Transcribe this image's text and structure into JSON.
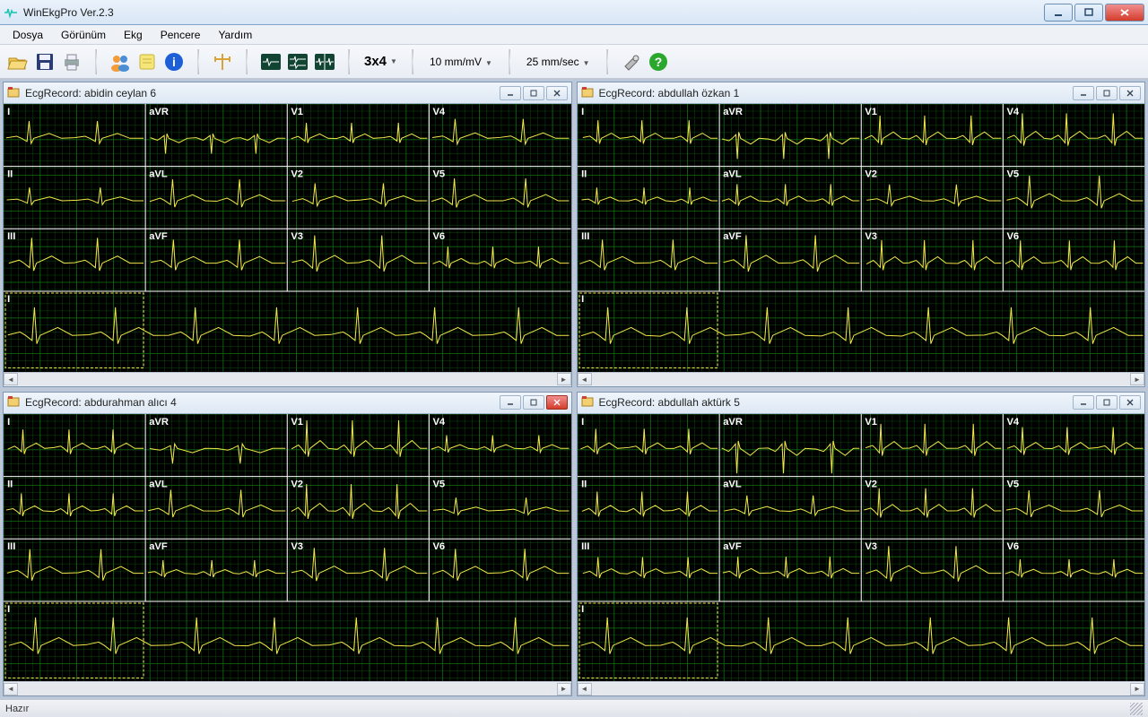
{
  "app": {
    "title": "WinEkgPro Ver.2.3"
  },
  "menu": {
    "items": [
      "Dosya",
      "Görünüm",
      "Ekg",
      "Pencere",
      "Yardım"
    ]
  },
  "toolbar": {
    "layout_label": "3x4",
    "gain": "10 mm/mV",
    "speed": "25 mm/sec"
  },
  "lead_labels": {
    "col0": [
      "I",
      "II",
      "III"
    ],
    "col1": [
      "aVR",
      "aVL",
      "aVF"
    ],
    "col2": [
      "V1",
      "V2",
      "V3"
    ],
    "col3": [
      "V4",
      "V5",
      "V6"
    ]
  },
  "windows": [
    {
      "title": "EcgRecord: abidin ceylan 6",
      "close_active": false
    },
    {
      "title": "EcgRecord: abdullah özkan 1",
      "close_active": false
    },
    {
      "title": "EcgRecord: abdurahman alıcı 4",
      "close_active": true
    },
    {
      "title": "EcgRecord: abdullah aktürk 5",
      "close_active": false
    }
  ],
  "status": {
    "text": "Hazır"
  }
}
